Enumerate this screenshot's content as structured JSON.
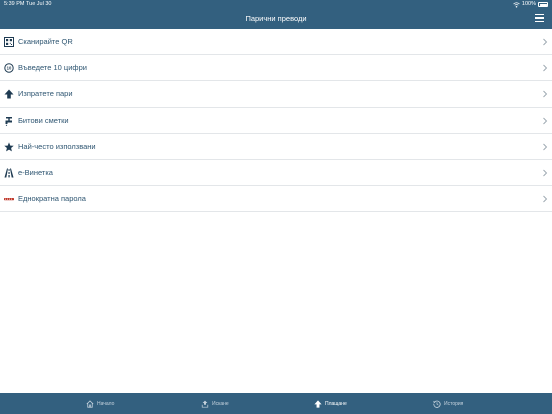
{
  "status_bar": {
    "time": "5:39 PM",
    "date": "Tue Jul 30",
    "battery": "100%"
  },
  "header": {
    "title": "Парични преводи"
  },
  "menu": {
    "items": [
      {
        "label": "Сканирайте QR",
        "icon": "qr-code-icon"
      },
      {
        "label": "Въведете 10 цифри",
        "icon": "digits-icon"
      },
      {
        "label": "Изпратете пари",
        "icon": "send-arrow-icon"
      },
      {
        "label": "Битови сметки",
        "icon": "utility-tap-icon"
      },
      {
        "label": "Най-често използвани",
        "icon": "star-icon"
      },
      {
        "label": "е-Винетка",
        "icon": "road-icon"
      },
      {
        "label": "Еднократна парола",
        "icon": "otp-icon"
      }
    ]
  },
  "tabbar": {
    "tabs": [
      {
        "label": "Начало",
        "icon": "home-icon",
        "active": false
      },
      {
        "label": "Искане",
        "icon": "request-icon",
        "active": false
      },
      {
        "label": "Плащане",
        "icon": "payment-icon",
        "active": true
      },
      {
        "label": "История",
        "icon": "history-icon",
        "active": false
      }
    ]
  },
  "colors": {
    "brand": "#33607f",
    "label": "#2f5672",
    "divider": "#e3e6e9",
    "otp_accent": "#c0392b"
  }
}
